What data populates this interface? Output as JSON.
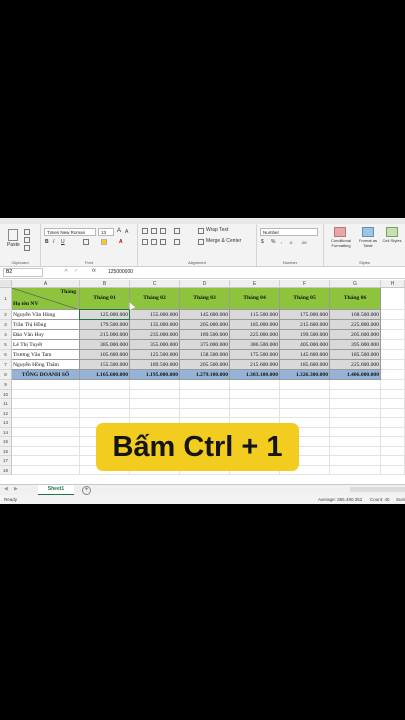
{
  "ribbon": {
    "font_name": "Times New Roman",
    "font_size": "13",
    "wrap_text": "Wrap Text",
    "merge_center": "Merge & Center",
    "number_format": "Number",
    "conditional_formatting": "Conditional Formatting",
    "format_as_table": "Format as Table",
    "cell_styles": "Cell Styles",
    "group_clipboard": "Clipboard",
    "group_font": "Font",
    "group_alignment": "Alignment",
    "group_number": "Number",
    "group_styles": "Styles",
    "paste": "Paste"
  },
  "formula_bar": {
    "name_box": "B2",
    "fx": "fx",
    "value": "125000000"
  },
  "columns": [
    "A",
    "B",
    "C",
    "D",
    "E",
    "F",
    "G",
    "H"
  ],
  "rows": [
    "1",
    "2",
    "3",
    "4",
    "5",
    "6",
    "7",
    "8",
    "9",
    "10",
    "11",
    "12",
    "13",
    "14",
    "15",
    "16",
    "17",
    "18"
  ],
  "table": {
    "corner_top": "Tháng",
    "corner_bottom": "Họ tên NV",
    "months": [
      "Tháng 01",
      "Tháng 02",
      "Tháng 03",
      "Tháng 04",
      "Tháng 05",
      "Tháng 06"
    ],
    "employees": [
      {
        "name": "Nguyễn Văn Hùng",
        "values": [
          "125.000.000",
          "155.000.000",
          "145.600.000",
          "115.500.000",
          "175.000.000",
          "168.500.000"
        ]
      },
      {
        "name": "Trần Thị Hồng",
        "values": [
          "179.500.000",
          "135.000.000",
          "205.000.000",
          "185.000.000",
          "215.600.000",
          "225.800.000"
        ]
      },
      {
        "name": "Đào Văn Huy",
        "values": [
          "215.000.000",
          "235.000.000",
          "189.500.000",
          "225.000.000",
          "199.500.000",
          "205.600.000"
        ]
      },
      {
        "name": "Lê Thị Tuyết",
        "values": [
          "385.000.000",
          "355.000.000",
          "375.000.000",
          "386.500.000",
          "405.000.000",
          "395.000.000"
        ]
      },
      {
        "name": "Trương Văn Tam",
        "values": [
          "105.600.000",
          "125.500.000",
          "158.500.000",
          "175.500.000",
          "145.600.000",
          "185.500.000"
        ]
      },
      {
        "name": "Nguyễn Hồng Thắm",
        "values": [
          "155.500.000",
          "189.500.000",
          "205.500.000",
          "215.600.000",
          "185.600.000",
          "225.600.000"
        ]
      }
    ],
    "total_label": "TỔNG DOANH SỐ",
    "totals": [
      "1.165.600.000",
      "1.195.000.000",
      "1.279.100.000",
      "1.303.100.000",
      "1.326.300.000",
      "1.406.000.000"
    ]
  },
  "sheet_tab": "Sheet1",
  "add_sheet": "+",
  "status": {
    "ready": "Ready",
    "average": "Average: 365.480.352",
    "count": "Count: 40",
    "sum": "Sum:"
  },
  "caption": "Bấm Ctrl + 1",
  "colors": {
    "header_green": "#8dc33d",
    "total_blue": "#95b3d7",
    "value_gray": "#d9d9d9",
    "caption_yellow": "#f2cc1f"
  }
}
